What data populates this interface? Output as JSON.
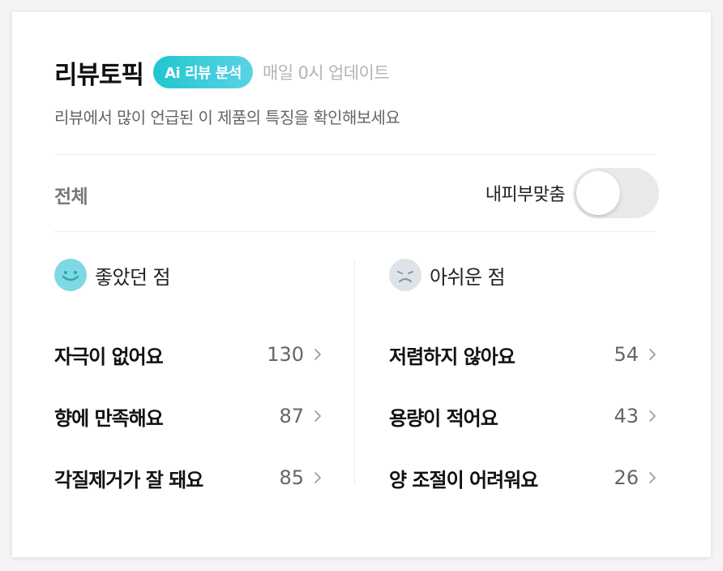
{
  "header": {
    "title": "리뷰토픽",
    "badge": "Ai 리뷰 분석",
    "update_note": "매일 0시 업데이트",
    "subtitle": "리뷰에서 많이 언급된 이 제품의 특징을 확인해보세요"
  },
  "filter": {
    "all_label": "전체",
    "toggle_label": "내피부맞춤",
    "toggle_on": false
  },
  "positive": {
    "title": "좋았던 점",
    "icon": "happy-face-icon",
    "items": [
      {
        "label": "자극이 없어요",
        "count": "130"
      },
      {
        "label": "향에 만족해요",
        "count": "87"
      },
      {
        "label": "각질제거가 잘 돼요",
        "count": "85"
      }
    ]
  },
  "negative": {
    "title": "아쉬운 점",
    "icon": "sad-face-icon",
    "items": [
      {
        "label": "저렴하지 않아요",
        "count": "54"
      },
      {
        "label": "용량이 적어요",
        "count": "43"
      },
      {
        "label": "양 조절이 어려워요",
        "count": "26"
      }
    ]
  },
  "colors": {
    "accent": "#20c6cf",
    "positive_face": "#7fd8e3",
    "negative_face": "#dde3e8"
  }
}
